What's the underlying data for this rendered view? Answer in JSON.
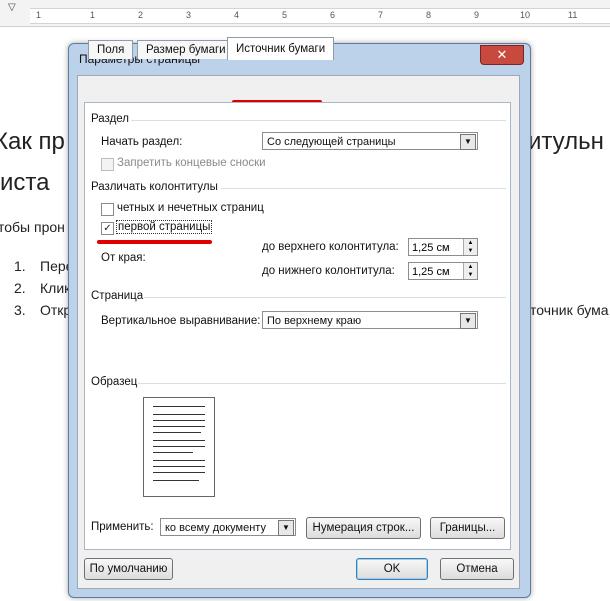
{
  "ruler": {
    "marks": [
      "1",
      "1",
      "2",
      "3",
      "4",
      "5",
      "6",
      "7",
      "8",
      "9",
      "10",
      "11"
    ]
  },
  "background_text": {
    "line1_left": "Как пр",
    "line1_right": "итульн",
    "line2": "иста",
    "line3": "тобы прон",
    "list": [
      {
        "num": "1.",
        "text": "Пере"
      },
      {
        "num": "2.",
        "text": "Клик"
      },
      {
        "num": "3.",
        "text": "Откр"
      }
    ],
    "list3_right": "точник бума"
  },
  "dialog": {
    "title": "Параметры страницы",
    "close": "✕",
    "tabs": [
      {
        "label": "Поля"
      },
      {
        "label": "Размер бумаги"
      },
      {
        "label": "Источник бумаги"
      }
    ],
    "section_label": "Раздел",
    "section_start_label": "Начать раздел:",
    "section_start_value": "Со следующей страницы",
    "suppress_endnotes": "Запретить концевые сноски",
    "headers_footers_label": "Различать колонтитулы",
    "odd_even": "четных и нечетных страниц",
    "first_page": "первой страницы",
    "from_edge_label": "От края:",
    "header_label": "до верхнего колонтитула:",
    "header_value": "1,25 см",
    "footer_label": "до нижнего колонтитула:",
    "footer_value": "1,25 см",
    "page_label": "Страница",
    "vertical_align_label": "Вертикальное выравнивание:",
    "vertical_align_value": "По верхнему краю",
    "preview_label": "Образец",
    "apply_label": "Применить:",
    "apply_value": "ко всему документу",
    "line_numbers_btn": "Нумерация строк...",
    "borders_btn": "Границы...",
    "default_btn": "По умолчанию",
    "ok_btn": "OK",
    "cancel_btn": "Отмена"
  },
  "colors": {
    "annotation_red": "#e00000",
    "dialog_frame": "#bcd2ea"
  }
}
